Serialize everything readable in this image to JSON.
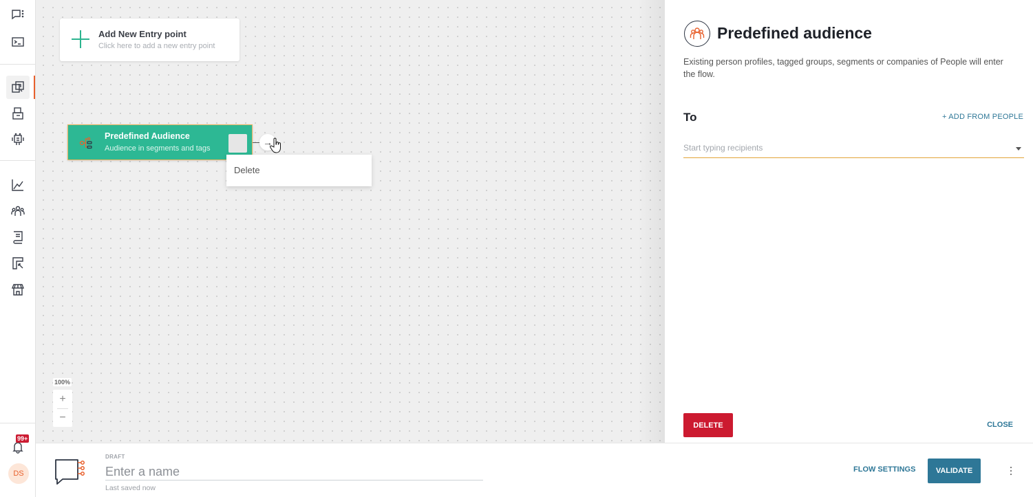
{
  "rail": {
    "items": [
      {
        "icon": "chat-menu-icon",
        "active": false
      },
      {
        "icon": "terminal-icon",
        "active": false
      },
      {
        "icon": "flows-icon",
        "active": true
      },
      {
        "icon": "inbox-icon",
        "active": false
      },
      {
        "icon": "bot-icon",
        "active": false
      },
      {
        "icon": "analytics-icon",
        "active": false
      },
      {
        "icon": "people-icon",
        "active": false
      },
      {
        "icon": "knowledge-book-icon",
        "active": false
      },
      {
        "icon": "widget-icon",
        "active": false
      },
      {
        "icon": "store-icon",
        "active": false
      }
    ],
    "notifications_badge": "99+",
    "avatar_initials": "DS",
    "accent_color": "#e8602c"
  },
  "canvas": {
    "add_entry": {
      "title": "Add New Entry point",
      "subtitle": "Click here to add a new entry point"
    },
    "node": {
      "title": "Predefined Audience",
      "subtitle": "Audience in segments and tags",
      "color": "#2db894"
    },
    "context_menu": {
      "items": [
        "Delete"
      ]
    },
    "zoom_level": "100%",
    "zoom_in": "+",
    "zoom_out": "−",
    "connector_arrow": "→"
  },
  "panel": {
    "title": "Predefined audience",
    "description": "Existing person profiles, tagged groups, segments or companies of People will enter the flow.",
    "to_label": "To",
    "add_from_people": "+ ADD FROM PEOPLE",
    "recipients_placeholder": "Start typing recipients",
    "delete_label": "DELETE",
    "close_label": "CLOSE"
  },
  "bottom": {
    "status": "DRAFT",
    "name_placeholder": "Enter a name",
    "name_value": "",
    "saved_text": "Last saved now",
    "flow_settings_label": "FLOW SETTINGS",
    "validate_label": "VALIDATE"
  }
}
